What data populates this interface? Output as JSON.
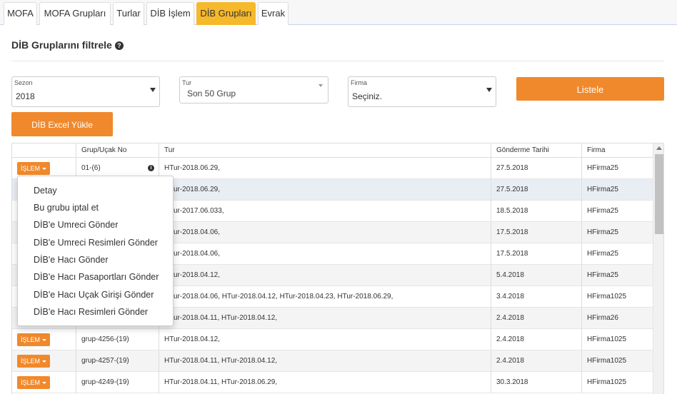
{
  "tabs": [
    {
      "label": "MOFA",
      "active": false
    },
    {
      "label": "MOFA Grupları",
      "active": false
    },
    {
      "label": "Turlar",
      "active": false
    },
    {
      "label": "DİB İşlem",
      "active": false
    },
    {
      "label": "DİB Grupları",
      "active": true
    },
    {
      "label": "Evrak",
      "active": false
    }
  ],
  "filter": {
    "title": "DİB Gruplarını filtrele",
    "help_icon": "question-circle-icon",
    "sezon": {
      "label": "Sezon",
      "value": "2018"
    },
    "tur": {
      "label": "Tur",
      "value": "Son 50 Grup"
    },
    "firma": {
      "label": "Firma",
      "value": "Seçiniz."
    },
    "listele_label": "Listele",
    "excel_label": "DİB Excel Yükle"
  },
  "table": {
    "columns": [
      "",
      "Grup/Uçak No",
      "Tur",
      "Gönderme Tarihi",
      "Firma"
    ],
    "action_label": "İŞLEM",
    "rows": [
      {
        "grup": "01-(6)",
        "tur": "HTur-2018.06.29,",
        "tarih": "27.5.2018",
        "firma": "HFirma25",
        "info": true
      },
      {
        "grup": "",
        "tur": "HTur-2018.06.29,",
        "tarih": "27.5.2018",
        "firma": "HFirma25"
      },
      {
        "grup": "",
        "tur": "HTur-2017.06.033,",
        "tarih": "18.5.2018",
        "firma": "HFirma25"
      },
      {
        "grup": "",
        "tur": "HTur-2018.04.06,",
        "tarih": "17.5.2018",
        "firma": "HFirma25"
      },
      {
        "grup": "",
        "tur": "HTur-2018.04.06,",
        "tarih": "17.5.2018",
        "firma": "HFirma25"
      },
      {
        "grup": "",
        "tur": "HTur-2018.04.12,",
        "tarih": "5.4.2018",
        "firma": "HFirma25"
      },
      {
        "grup": "",
        "tur": "HTur-2018.04.06, HTur-2018.04.12, HTur-2018.04.23, HTur-2018.06.29,",
        "tarih": "3.4.2018",
        "firma": "HFirma1025"
      },
      {
        "grup": "",
        "tur": "HTur-2018.04.11, HTur-2018.04.12,",
        "tarih": "2.4.2018",
        "firma": "HFirma26"
      },
      {
        "grup": "grup-4256-(19)",
        "tur": "HTur-2018.04.12,",
        "tarih": "2.4.2018",
        "firma": "HFirma1025"
      },
      {
        "grup": "grup-4257-(19)",
        "tur": "HTur-2018.04.11, HTur-2018.04.12,",
        "tarih": "2.4.2018",
        "firma": "HFirma1025"
      },
      {
        "grup": "grup-4249-(19)",
        "tur": "HTur-2018.04.11, HTur-2018.06.29,",
        "tarih": "30.3.2018",
        "firma": "HFirma1025"
      }
    ]
  },
  "dropdown_menu": [
    "Detay",
    "Bu grubu iptal et",
    "DİB'e Umreci Gönder",
    "DİB'e Umreci Resimleri Gönder",
    "DİB'e Hacı Gönder",
    "DİB'e Hacı Pasaportları Gönder",
    "DİB'e Hacı Uçak Girişi Gönder",
    "DİB'e Hacı Resimleri Gönder"
  ]
}
